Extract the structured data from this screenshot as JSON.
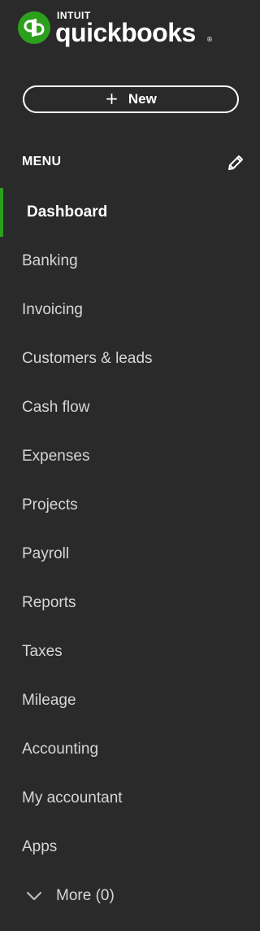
{
  "brand": {
    "top_text": "INTUIT",
    "wordmark": "quickbooks",
    "registered": "®",
    "colors": {
      "green": "#2ca01c",
      "background": "#2a2a2a",
      "text": "#ffffff"
    }
  },
  "new_button": {
    "plus": "+",
    "label": "New"
  },
  "menu": {
    "title": "MENU",
    "items": [
      {
        "label": "Dashboard",
        "active": true
      },
      {
        "label": "Banking"
      },
      {
        "label": "Invoicing"
      },
      {
        "label": "Customers & leads"
      },
      {
        "label": "Cash flow"
      },
      {
        "label": "Expenses"
      },
      {
        "label": "Projects"
      },
      {
        "label": "Payroll"
      },
      {
        "label": "Reports"
      },
      {
        "label": "Taxes"
      },
      {
        "label": "Mileage"
      },
      {
        "label": "Accounting"
      },
      {
        "label": "My accountant"
      },
      {
        "label": "Apps"
      }
    ],
    "more_label": "More (0)"
  },
  "icons": {
    "logo": "quickbooks-logo-icon",
    "edit": "pencil-icon",
    "more": "chevron-down-icon"
  }
}
